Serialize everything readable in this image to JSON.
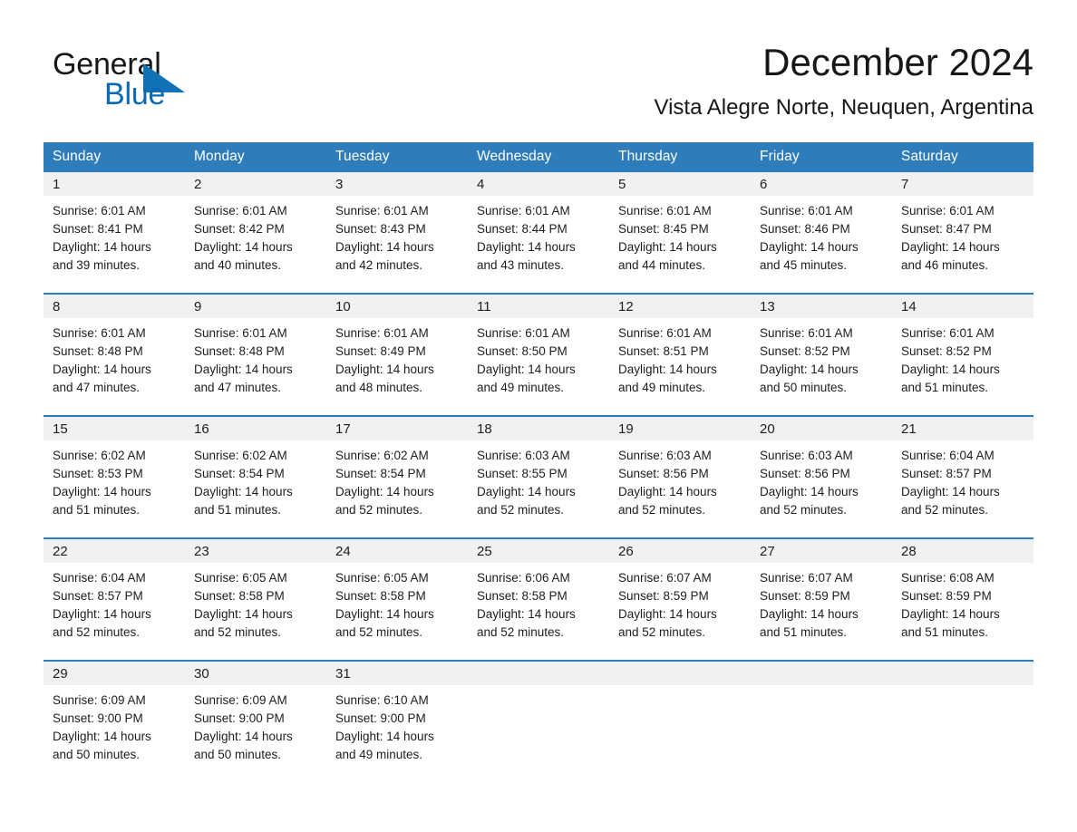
{
  "brand": {
    "name_part1": "General",
    "name_part2": "Blue",
    "accent_color": "#0b69b4",
    "triangle_icon": "triangle-icon"
  },
  "header": {
    "title": "December 2024",
    "location": "Vista Alegre Norte, Neuquen, Argentina"
  },
  "calendar": {
    "header_bg": "#2e7cba",
    "daynum_bg": "#f1f1f1",
    "weekday_names": [
      "Sunday",
      "Monday",
      "Tuesday",
      "Wednesday",
      "Thursday",
      "Friday",
      "Saturday"
    ],
    "weeks": [
      [
        {
          "day": "1",
          "sunrise": "Sunrise: 6:01 AM",
          "sunset": "Sunset: 8:41 PM",
          "daylight_line1": "Daylight: 14 hours",
          "daylight_line2": "and 39 minutes."
        },
        {
          "day": "2",
          "sunrise": "Sunrise: 6:01 AM",
          "sunset": "Sunset: 8:42 PM",
          "daylight_line1": "Daylight: 14 hours",
          "daylight_line2": "and 40 minutes."
        },
        {
          "day": "3",
          "sunrise": "Sunrise: 6:01 AM",
          "sunset": "Sunset: 8:43 PM",
          "daylight_line1": "Daylight: 14 hours",
          "daylight_line2": "and 42 minutes."
        },
        {
          "day": "4",
          "sunrise": "Sunrise: 6:01 AM",
          "sunset": "Sunset: 8:44 PM",
          "daylight_line1": "Daylight: 14 hours",
          "daylight_line2": "and 43 minutes."
        },
        {
          "day": "5",
          "sunrise": "Sunrise: 6:01 AM",
          "sunset": "Sunset: 8:45 PM",
          "daylight_line1": "Daylight: 14 hours",
          "daylight_line2": "and 44 minutes."
        },
        {
          "day": "6",
          "sunrise": "Sunrise: 6:01 AM",
          "sunset": "Sunset: 8:46 PM",
          "daylight_line1": "Daylight: 14 hours",
          "daylight_line2": "and 45 minutes."
        },
        {
          "day": "7",
          "sunrise": "Sunrise: 6:01 AM",
          "sunset": "Sunset: 8:47 PM",
          "daylight_line1": "Daylight: 14 hours",
          "daylight_line2": "and 46 minutes."
        }
      ],
      [
        {
          "day": "8",
          "sunrise": "Sunrise: 6:01 AM",
          "sunset": "Sunset: 8:48 PM",
          "daylight_line1": "Daylight: 14 hours",
          "daylight_line2": "and 47 minutes."
        },
        {
          "day": "9",
          "sunrise": "Sunrise: 6:01 AM",
          "sunset": "Sunset: 8:48 PM",
          "daylight_line1": "Daylight: 14 hours",
          "daylight_line2": "and 47 minutes."
        },
        {
          "day": "10",
          "sunrise": "Sunrise: 6:01 AM",
          "sunset": "Sunset: 8:49 PM",
          "daylight_line1": "Daylight: 14 hours",
          "daylight_line2": "and 48 minutes."
        },
        {
          "day": "11",
          "sunrise": "Sunrise: 6:01 AM",
          "sunset": "Sunset: 8:50 PM",
          "daylight_line1": "Daylight: 14 hours",
          "daylight_line2": "and 49 minutes."
        },
        {
          "day": "12",
          "sunrise": "Sunrise: 6:01 AM",
          "sunset": "Sunset: 8:51 PM",
          "daylight_line1": "Daylight: 14 hours",
          "daylight_line2": "and 49 minutes."
        },
        {
          "day": "13",
          "sunrise": "Sunrise: 6:01 AM",
          "sunset": "Sunset: 8:52 PM",
          "daylight_line1": "Daylight: 14 hours",
          "daylight_line2": "and 50 minutes."
        },
        {
          "day": "14",
          "sunrise": "Sunrise: 6:01 AM",
          "sunset": "Sunset: 8:52 PM",
          "daylight_line1": "Daylight: 14 hours",
          "daylight_line2": "and 51 minutes."
        }
      ],
      [
        {
          "day": "15",
          "sunrise": "Sunrise: 6:02 AM",
          "sunset": "Sunset: 8:53 PM",
          "daylight_line1": "Daylight: 14 hours",
          "daylight_line2": "and 51 minutes."
        },
        {
          "day": "16",
          "sunrise": "Sunrise: 6:02 AM",
          "sunset": "Sunset: 8:54 PM",
          "daylight_line1": "Daylight: 14 hours",
          "daylight_line2": "and 51 minutes."
        },
        {
          "day": "17",
          "sunrise": "Sunrise: 6:02 AM",
          "sunset": "Sunset: 8:54 PM",
          "daylight_line1": "Daylight: 14 hours",
          "daylight_line2": "and 52 minutes."
        },
        {
          "day": "18",
          "sunrise": "Sunrise: 6:03 AM",
          "sunset": "Sunset: 8:55 PM",
          "daylight_line1": "Daylight: 14 hours",
          "daylight_line2": "and 52 minutes."
        },
        {
          "day": "19",
          "sunrise": "Sunrise: 6:03 AM",
          "sunset": "Sunset: 8:56 PM",
          "daylight_line1": "Daylight: 14 hours",
          "daylight_line2": "and 52 minutes."
        },
        {
          "day": "20",
          "sunrise": "Sunrise: 6:03 AM",
          "sunset": "Sunset: 8:56 PM",
          "daylight_line1": "Daylight: 14 hours",
          "daylight_line2": "and 52 minutes."
        },
        {
          "day": "21",
          "sunrise": "Sunrise: 6:04 AM",
          "sunset": "Sunset: 8:57 PM",
          "daylight_line1": "Daylight: 14 hours",
          "daylight_line2": "and 52 minutes."
        }
      ],
      [
        {
          "day": "22",
          "sunrise": "Sunrise: 6:04 AM",
          "sunset": "Sunset: 8:57 PM",
          "daylight_line1": "Daylight: 14 hours",
          "daylight_line2": "and 52 minutes."
        },
        {
          "day": "23",
          "sunrise": "Sunrise: 6:05 AM",
          "sunset": "Sunset: 8:58 PM",
          "daylight_line1": "Daylight: 14 hours",
          "daylight_line2": "and 52 minutes."
        },
        {
          "day": "24",
          "sunrise": "Sunrise: 6:05 AM",
          "sunset": "Sunset: 8:58 PM",
          "daylight_line1": "Daylight: 14 hours",
          "daylight_line2": "and 52 minutes."
        },
        {
          "day": "25",
          "sunrise": "Sunrise: 6:06 AM",
          "sunset": "Sunset: 8:58 PM",
          "daylight_line1": "Daylight: 14 hours",
          "daylight_line2": "and 52 minutes."
        },
        {
          "day": "26",
          "sunrise": "Sunrise: 6:07 AM",
          "sunset": "Sunset: 8:59 PM",
          "daylight_line1": "Daylight: 14 hours",
          "daylight_line2": "and 52 minutes."
        },
        {
          "day": "27",
          "sunrise": "Sunrise: 6:07 AM",
          "sunset": "Sunset: 8:59 PM",
          "daylight_line1": "Daylight: 14 hours",
          "daylight_line2": "and 51 minutes."
        },
        {
          "day": "28",
          "sunrise": "Sunrise: 6:08 AM",
          "sunset": "Sunset: 8:59 PM",
          "daylight_line1": "Daylight: 14 hours",
          "daylight_line2": "and 51 minutes."
        }
      ],
      [
        {
          "day": "29",
          "sunrise": "Sunrise: 6:09 AM",
          "sunset": "Sunset: 9:00 PM",
          "daylight_line1": "Daylight: 14 hours",
          "daylight_line2": "and 50 minutes."
        },
        {
          "day": "30",
          "sunrise": "Sunrise: 6:09 AM",
          "sunset": "Sunset: 9:00 PM",
          "daylight_line1": "Daylight: 14 hours",
          "daylight_line2": "and 50 minutes."
        },
        {
          "day": "31",
          "sunrise": "Sunrise: 6:10 AM",
          "sunset": "Sunset: 9:00 PM",
          "daylight_line1": "Daylight: 14 hours",
          "daylight_line2": "and 49 minutes."
        },
        {
          "day": "",
          "sunrise": "",
          "sunset": "",
          "daylight_line1": "",
          "daylight_line2": ""
        },
        {
          "day": "",
          "sunrise": "",
          "sunset": "",
          "daylight_line1": "",
          "daylight_line2": ""
        },
        {
          "day": "",
          "sunrise": "",
          "sunset": "",
          "daylight_line1": "",
          "daylight_line2": ""
        },
        {
          "day": "",
          "sunrise": "",
          "sunset": "",
          "daylight_line1": "",
          "daylight_line2": ""
        }
      ]
    ]
  }
}
